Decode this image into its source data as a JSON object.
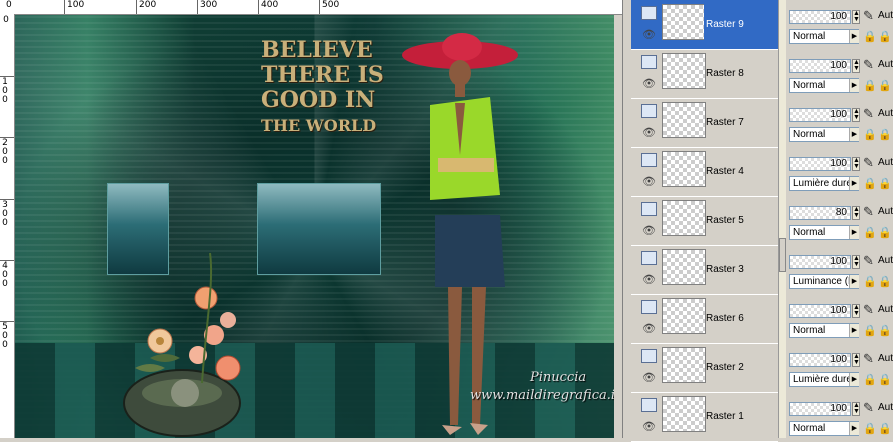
{
  "ruler": {
    "top_labels": [
      "0",
      "100",
      "200",
      "300",
      "400",
      "500"
    ],
    "left_labels": [
      "0",
      "1 0 0",
      "2 0 0",
      "3 0 0",
      "4 0 0",
      "5 0 0"
    ]
  },
  "artwork": {
    "text_lines": [
      "BELIEVE",
      "THERE IS",
      "GOOD IN",
      "THE WORLD"
    ],
    "watermark_line1": "Pinuccia",
    "watermark_line2": "www.maildiregrafica.it"
  },
  "layers": [
    {
      "name": "Raster 9",
      "selected": true,
      "opacity": "100",
      "blend": "Normal"
    },
    {
      "name": "Raster 8",
      "selected": false,
      "opacity": "100",
      "blend": "Normal"
    },
    {
      "name": "Raster 7",
      "selected": false,
      "opacity": "100",
      "blend": "Normal"
    },
    {
      "name": "Raster 4",
      "selected": false,
      "opacity": "100",
      "blend": "Lumière dure"
    },
    {
      "name": "Raster 5",
      "selected": false,
      "opacity": "80",
      "blend": "Normal"
    },
    {
      "name": "Raster 3",
      "selected": false,
      "opacity": "100",
      "blend": "Luminance (H)"
    },
    {
      "name": "Raster 6",
      "selected": false,
      "opacity": "100",
      "blend": "Normal"
    },
    {
      "name": "Raster 2",
      "selected": false,
      "opacity": "100",
      "blend": "Lumière dure"
    },
    {
      "name": "Raster 1",
      "selected": false,
      "opacity": "100",
      "blend": "Normal"
    }
  ],
  "auto_label": "Aut",
  "icons": {
    "visibility": "eye-icon",
    "group": "layer-group-icon",
    "brush": "paint-brush-icon",
    "lock": "lock-icon"
  }
}
